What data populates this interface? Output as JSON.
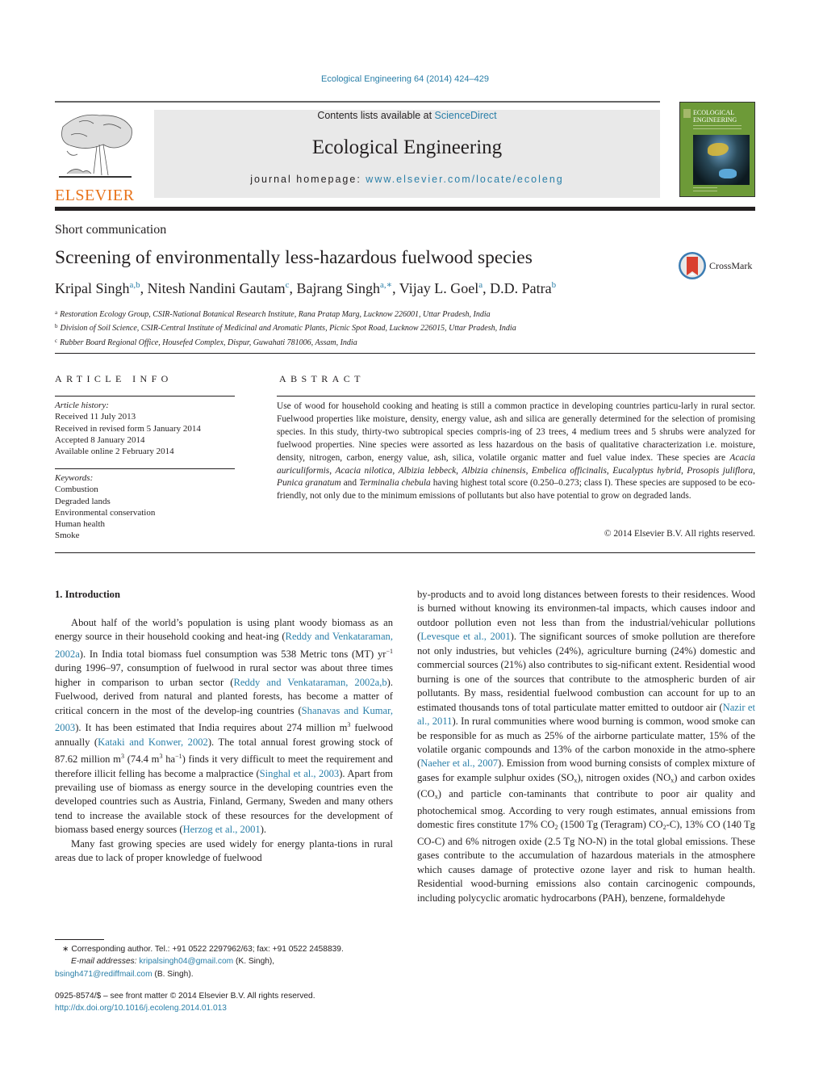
{
  "header": {
    "citation": "Ecological Engineering 64 (2014) 424–429",
    "contents_prefix": "Contents lists available at ",
    "contents_link": "ScienceDirect",
    "journal_name": "Ecological Engineering",
    "homepage_prefix": "journal homepage: ",
    "homepage_link": "www.elsevier.com/locate/ecoleng",
    "publisher": "ELSEVIER",
    "cover_title_1": "ECOLOGICAL",
    "cover_title_2": "ENGINEERING",
    "crossmark": "CrossMark"
  },
  "article": {
    "type": "Short communication",
    "title": "Screening of environmentally less-hazardous fuelwood species",
    "authors": [
      {
        "name": "Kripal Singh",
        "sup": "a,b",
        "sep": ", "
      },
      {
        "name": "Nitesh Nandini Gautam",
        "sup": "c",
        "sep": ", "
      },
      {
        "name": "Bajrang Singh",
        "sup": "a,∗",
        "sep": ", "
      },
      {
        "name": "Vijay L. Goel",
        "sup": "a",
        "sep": ", "
      },
      {
        "name": "D.D. Patra",
        "sup": "b",
        "sep": ""
      }
    ],
    "affiliations": [
      {
        "key": "a",
        "text": "Restoration Ecology Group, CSIR-National Botanical Research Institute, Rana Pratap Marg, Lucknow 226001, Uttar Pradesh, India"
      },
      {
        "key": "b",
        "text": "Division of Soil Science, CSIR-Central Institute of Medicinal and Aromatic Plants, Picnic Spot Road, Lucknow 226015, Uttar Pradesh, India"
      },
      {
        "key": "c",
        "text": "Rubber Board Regional Office, Housefed Complex, Dispur, Guwahati 781006, Assam, India"
      }
    ]
  },
  "article_info": {
    "heading": "ARTICLE INFO",
    "history_label": "Article history:",
    "history": [
      "Received 11 July 2013",
      "Received in revised form 5 January 2014",
      "Accepted 8 January 2014",
      "Available online 2 February 2014"
    ],
    "keywords_label": "Keywords:",
    "keywords": [
      "Combustion",
      "Degraded lands",
      "Environmental conservation",
      "Human health",
      "Smoke"
    ]
  },
  "abstract": {
    "heading": "ABSTRACT",
    "part1": "Use of wood for household cooking and heating is still a common practice in developing countries particu-larly in rural sector. Fuelwood properties like moisture, density, energy value, ash and silica are generally determined for the selection of promising species. In this study, thirty-two subtropical species compris-ing of 23 trees, 4 medium trees and 5 shrubs were analyzed for fuelwood properties. Nine species were assorted as less hazardous on the basis of qualitative characterization i.e. moisture, density, nitrogen, carbon, energy value, ash, silica, volatile organic matter and fuel value index. These species are ",
    "species": [
      "Aca-cia auriculiformis",
      "Acacia nilotica",
      "Albizia lebbeck",
      "Albizia chinensis",
      "Embelica officinalis",
      "Eucalyptus hybrid",
      "Prosopis juliflora",
      "Punica granatum",
      "Terminalia chebula"
    ],
    "part2": " having highest total score (0.250–0.273; class I). These species are supposed to be eco-friendly, not only due to the minimum emissions of pollutants but also have potential to grow on degraded lands.",
    "copyright": "© 2014 Elsevier B.V. All rights reserved."
  },
  "body": {
    "intro_heading": "1.  Introduction",
    "left": {
      "p1": [
        {
          "t": "About half of the world’s population is using plant woody biomass as an energy source in their household cooking and heat-ing "
        },
        {
          "t": "(",
          "k": "plain"
        },
        {
          "t": "Reddy and Venkataraman, 2002a",
          "k": "link"
        },
        {
          "t": "). In India total biomass fuel consumption was 538 Metric tons (MT) yr"
        },
        {
          "t": "−1",
          "k": "sup"
        },
        {
          "t": " during 1996–97, consumption of fuelwood in rural sector was about three times higher in comparison to urban sector ("
        },
        {
          "t": "Reddy and Venkataraman, 2002a,b",
          "k": "link"
        },
        {
          "t": "). Fuelwood, derived from natural and planted forests, has become a matter of critical concern in the most of the develop-ing countries ("
        },
        {
          "t": "Shanavas and Kumar, 2003",
          "k": "link"
        },
        {
          "t": "). It has been estimated that India requires about 274 million m"
        },
        {
          "t": "3",
          "k": "sup"
        },
        {
          "t": " fuelwood annually ("
        },
        {
          "t": "Kataki and Konwer, 2002",
          "k": "link"
        },
        {
          "t": "). The total annual forest growing stock of 87.62 million m"
        },
        {
          "t": "3",
          "k": "sup"
        },
        {
          "t": " (74.4 m"
        },
        {
          "t": "3",
          "k": "sup"
        },
        {
          "t": " ha"
        },
        {
          "t": "−1",
          "k": "sup"
        },
        {
          "t": ") finds it very difficult to meet the requirement and therefore illicit felling has become a malpractice ("
        },
        {
          "t": "Singhal et al., 2003",
          "k": "link"
        },
        {
          "t": "). Apart from prevailing use of biomass as energy source in the developing countries even the developed countries such as Austria, Finland, Germany, Sweden and many others tend to increase the available stock of these resources for the development of biomass based energy sources ("
        },
        {
          "t": "Herzog et al., 2001",
          "k": "link"
        },
        {
          "t": ")."
        }
      ],
      "p2": [
        {
          "t": "Many fast growing species are used widely for energy planta-tions in rural areas due to lack of proper knowledge of fuelwood"
        }
      ]
    },
    "right": {
      "p1": [
        {
          "t": "by-products and to avoid long distances between forests to their residences. Wood is burned without knowing its environmen-tal impacts, which causes indoor and outdoor pollution even not less than from the industrial/vehicular pollutions ("
        },
        {
          "t": "Levesque et al., 2001",
          "k": "link"
        },
        {
          "t": "). The significant sources of smoke pollution are therefore not only industries, but vehicles (24%), agriculture burning (24%) domestic and commercial sources (21%) also contributes to sig-nificant extent. Residential wood burning is one of the sources that contribute to the atmospheric burden of air pollutants. By mass, residential fuelwood combustion can account for up to an estimated thousands tons of total particulate matter emitted to outdoor air ("
        },
        {
          "t": "Nazir et al., 2011",
          "k": "link"
        },
        {
          "t": "). In rural communities where wood burning is common, wood smoke can be responsible for as much as 25% of the airborne particulate matter, 15% of the volatile organic compounds and 13% of the carbon monoxide in the atmo-sphere ("
        },
        {
          "t": "Naeher et al., 2007",
          "k": "link"
        },
        {
          "t": "). Emission from wood burning consists of complex mixture of gases for example sulphur oxides (SO"
        },
        {
          "t": "x",
          "k": "sub"
        },
        {
          "t": "), nitrogen oxides (NO"
        },
        {
          "t": "x",
          "k": "sub"
        },
        {
          "t": ") and carbon oxides (CO"
        },
        {
          "t": "x",
          "k": "sub"
        },
        {
          "t": ") and particle con-taminants that contribute to poor air quality and photochemical smog. According to very rough estimates, annual emissions from domestic fires constitute 17% CO"
        },
        {
          "t": "2",
          "k": "sub"
        },
        {
          "t": " (1500 Tg (Teragram) CO"
        },
        {
          "t": "2",
          "k": "sub"
        },
        {
          "t": "-C), 13% CO (140 Tg CO-C) and 6% nitrogen oxide (2.5 Tg NO-N) in the total global emissions. These gases contribute to the accumulation of hazardous materials in the atmosphere which causes damage of protective ozone layer and risk to human health. Residential wood-burning emissions also contain carcinogenic compounds, including polycyclic aromatic hydrocarbons (PAH), benzene, formaldehyde"
        }
      ]
    }
  },
  "footnote": {
    "corresponding": "∗  Corresponding author. Tel.: +91 0522 2297962/63; fax: +91 0522 2458839.",
    "email_label": "E-mail addresses: ",
    "email1": "kripalsingh04@gmail.com",
    "email1_name": " (K. Singh),",
    "email2": "bsingh471@rediffmail.com",
    "email2_name": " (B. Singh)."
  },
  "issn": {
    "line": "0925-8574/$ – see front matter © 2014 Elsevier B.V. All rights reserved.",
    "doi": "http://dx.doi.org/10.1016/j.ecoleng.2014.01.013"
  }
}
